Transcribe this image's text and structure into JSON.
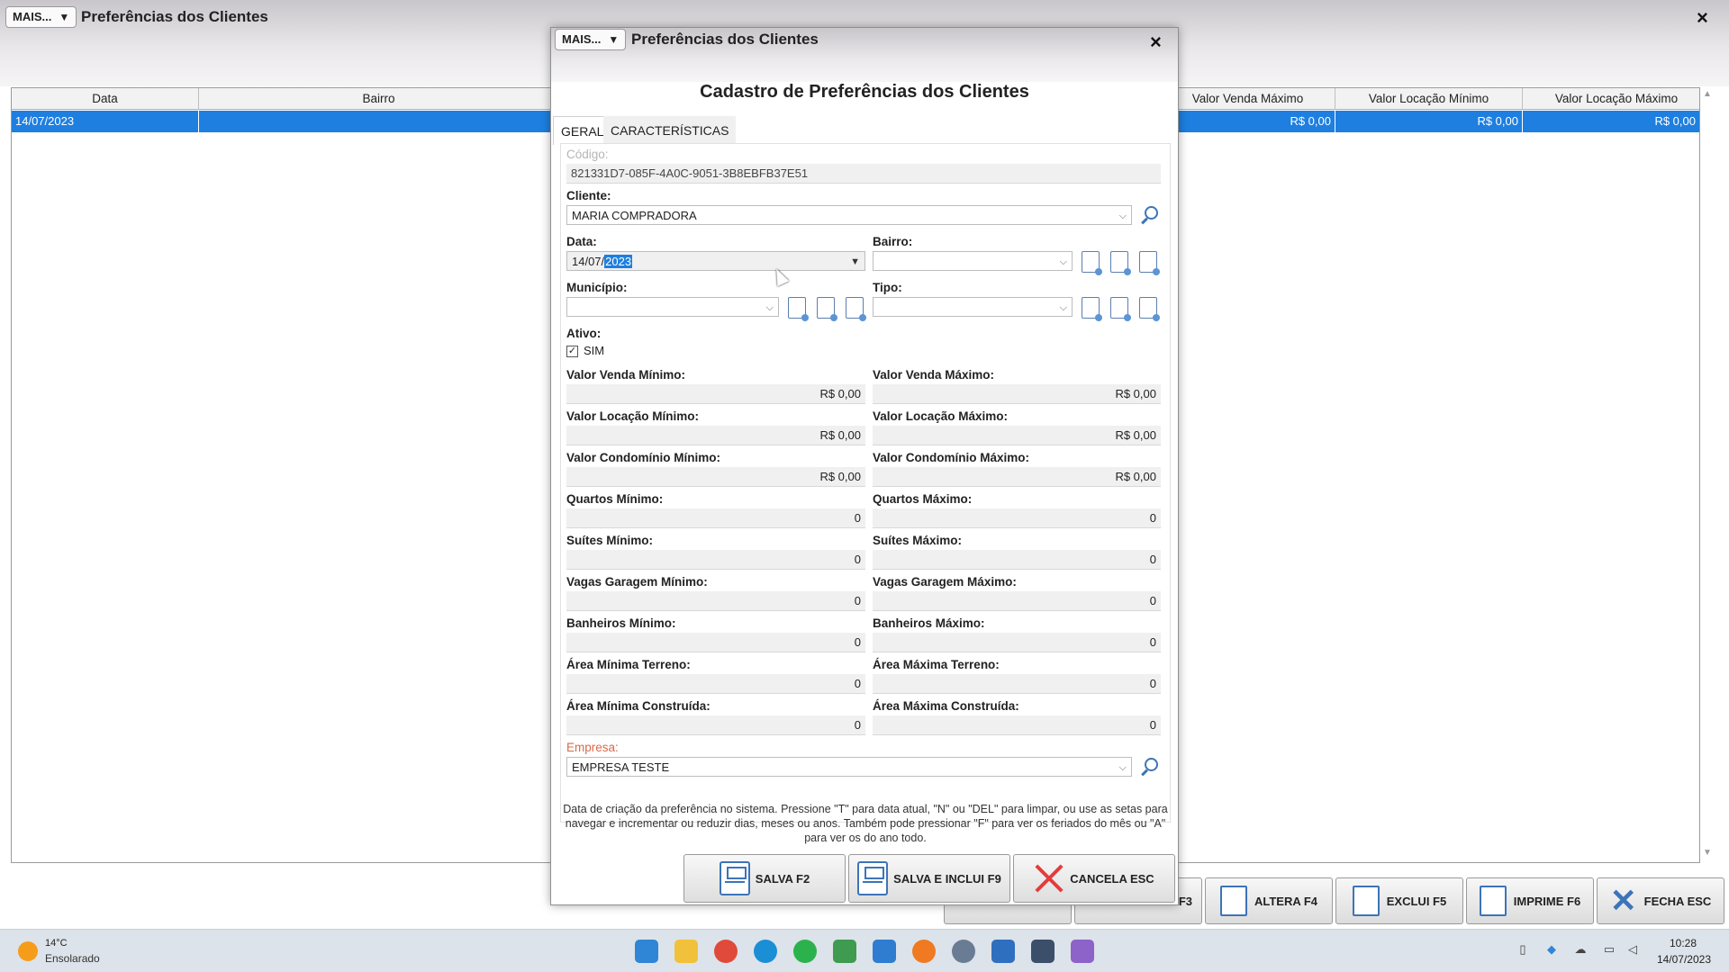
{
  "main": {
    "mais_label": "MAIS...",
    "title": "Preferências dos Clientes",
    "close_label": "×",
    "grid": {
      "columns": [
        "Data",
        "Bairro",
        "Valor Venda Máximo",
        "Valor Locação Mínimo",
        "Valor Locação Máximo"
      ],
      "row": {
        "data": "14/07/2023",
        "bairro": "",
        "valor_venda_maximo": "R$ 0,00",
        "valor_locacao_minimo": "R$ 0,00",
        "valor_locacao_maximo": "R$ 0,00"
      }
    },
    "buttons": {
      "f3": "F3",
      "altera": "ALTERA F4",
      "exclui": "EXCLUI F5",
      "imprime": "IMPRIME F6",
      "fecha": "FECHA ESC"
    }
  },
  "dialog": {
    "mais_label": "MAIS...",
    "title": "Preferências dos Clientes",
    "close_label": "×",
    "heading": "Cadastro de Preferências dos Clientes",
    "tabs": [
      {
        "label": "GERAL",
        "active": true
      },
      {
        "label": "CARACTERÍSTICAS",
        "active": false
      }
    ],
    "fields": {
      "codigo_label": "Código:",
      "codigo_value": "821331D7-085F-4A0C-9051-3B8EBFB37E51",
      "cliente_label": "Cliente:",
      "cliente_value": "MARIA COMPRADORA",
      "data_label": "Data:",
      "data_value_prefix": "14/07/",
      "data_value_selected": "2023",
      "bairro_label": "Bairro:",
      "bairro_value": "",
      "municipio_label": "Município:",
      "municipio_value": "",
      "tipo_label": "Tipo:",
      "tipo_value": "",
      "ativo_label": "Ativo:",
      "ativo_check_label": "SIM",
      "ativo_checked": true,
      "venda_min_label": "Valor Venda Mínimo:",
      "venda_min_value": "R$ 0,00",
      "venda_max_label": "Valor Venda Máximo:",
      "venda_max_value": "R$ 0,00",
      "locacao_min_label": "Valor Locação Mínimo:",
      "locacao_min_value": "R$ 0,00",
      "locacao_max_label": "Valor Locação Máximo:",
      "locacao_max_value": "R$ 0,00",
      "condominio_min_label": "Valor Condomínio Mínimo:",
      "condominio_min_value": "R$ 0,00",
      "condominio_max_label": "Valor Condomínio Máximo:",
      "condominio_max_value": "R$ 0,00",
      "quartos_min_label": "Quartos Mínimo:",
      "quartos_min_value": "0",
      "quartos_max_label": "Quartos Máximo:",
      "quartos_max_value": "0",
      "suites_min_label": "Suítes Mínimo:",
      "suites_min_value": "0",
      "suites_max_label": "Suítes Máximo:",
      "suites_max_value": "0",
      "vagas_min_label": "Vagas Garagem Mínimo:",
      "vagas_min_value": "0",
      "vagas_max_label": "Vagas Garagem Máximo:",
      "vagas_max_value": "0",
      "banheiros_min_label": "Banheiros Mínimo:",
      "banheiros_min_value": "0",
      "banheiros_max_label": "Banheiros Máximo:",
      "banheiros_max_value": "0",
      "area_min_terreno_label": "Área Mínima Terreno:",
      "area_min_terreno_value": "0",
      "area_max_terreno_label": "Área Máxima Terreno:",
      "area_max_terreno_value": "0",
      "area_min_construida_label": "Área Mínima Construída:",
      "area_min_construida_value": "0",
      "area_max_construida_label": "Área Máxima Construída:",
      "area_max_construida_value": "0",
      "empresa_label": "Empresa:",
      "empresa_value": "EMPRESA TESTE"
    },
    "help_text": "Data de criação da preferência no sistema. Pressione \"T\" para data atual, \"N\" ou \"DEL\" para limpar, ou use as setas para navegar e incrementar ou reduzir dias, meses ou anos. Também pode pressionar \"F\" para ver os feriados do mês ou \"A\" para ver os do ano todo.",
    "buttons": {
      "salva": "SALVA F2",
      "salva_inclui": "SALVA E INCLUI F9",
      "cancela": "CANCELA ESC"
    }
  },
  "taskbar": {
    "temperature": "14°C",
    "weather": "Ensolarado",
    "time": "10:28",
    "date": "14/07/2023"
  },
  "colors": {
    "selection": "#1e7fe0",
    "accent_icon": "#3d74b8",
    "empresa_label": "#d86a4a",
    "cancel_x": "#e53b3b"
  }
}
